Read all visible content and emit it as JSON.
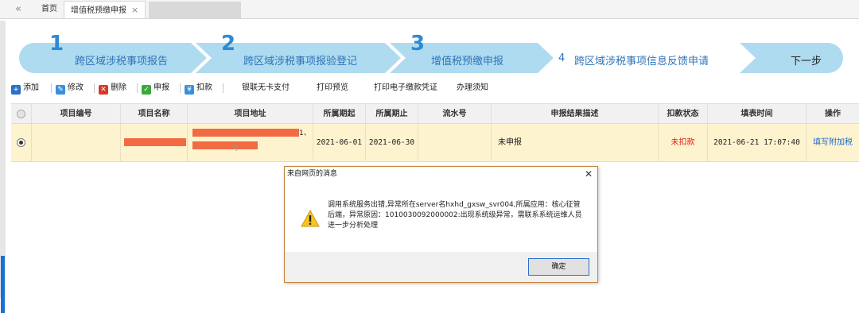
{
  "tabs": {
    "back_glyph": "«",
    "home": "首页",
    "active": "增值税预缴申报",
    "close_glyph": "×"
  },
  "steps": [
    {
      "num": "1",
      "label": "跨区域涉税事项报告"
    },
    {
      "num": "2",
      "label": "跨区域涉税事项报验登记"
    },
    {
      "num": "3",
      "label": "增值税预缴申报"
    },
    {
      "num": "4",
      "label": "跨区域涉税事项信息反馈申请"
    },
    {
      "num": "",
      "label": "下一步"
    }
  ],
  "toolbar": {
    "add": "添加",
    "edit": "修改",
    "delete": "删除",
    "declare": "申报",
    "deduct": "扣款",
    "unionpay": "银联无卡支付",
    "print_preview": "打印预览",
    "print_voucher": "打印电子缴款凭证",
    "notice": "办理须知"
  },
  "table": {
    "headers": [
      "项目编号",
      "项目名称",
      "项目地址",
      "所属期起",
      "所属期止",
      "流水号",
      "申报结果描述",
      "扣款状态",
      "填表时间",
      "操作"
    ],
    "row": {
      "address_suffix": "1、",
      "address_line2_suffix": "号",
      "period_start": "2021-06-01",
      "period_end": "2021-06-30",
      "serial": "",
      "result": "未申报",
      "deduct_status": "未扣款",
      "fill_time": "2021-06-21 17:07:40",
      "action": "填写附加税"
    }
  },
  "dialog": {
    "title": "来自网页的消息",
    "close_glyph": "✕",
    "message": "调用系统服务出错,异常所在server名hxhd_gxsw_svr004,所属应用：核心征管后端，异常原因：1010030092000002:出现系统级异常，需联系系统运维人员进一步分析处理",
    "ok": "确定"
  },
  "colors": {
    "step_fill": "#aedbf0",
    "step_accent": "#2d8ad6",
    "row_highlight": "#fdf3cf",
    "status_red": "#e0251b",
    "link_blue": "#1f6bd1",
    "redaction": "#f26b43"
  }
}
